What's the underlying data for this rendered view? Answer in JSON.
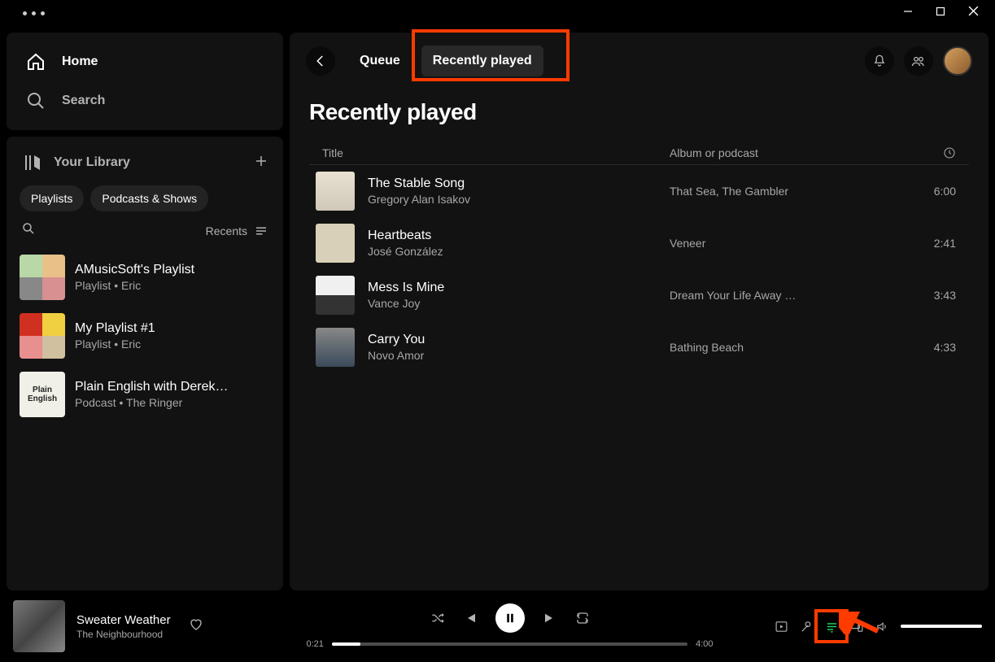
{
  "sidebar": {
    "home": "Home",
    "search": "Search",
    "library": "Your Library",
    "filters": [
      "Playlists",
      "Podcasts & Shows"
    ],
    "recents_label": "Recents",
    "items": [
      {
        "name": "AMusicSoft's Playlist",
        "meta": "Playlist • Eric"
      },
      {
        "name": "My Playlist #1",
        "meta": "Playlist • Eric"
      },
      {
        "name": "Plain English with Derek…",
        "meta": "Podcast • The Ringer"
      }
    ]
  },
  "main": {
    "tabs": {
      "queue": "Queue",
      "recently_played": "Recently played"
    },
    "page_title": "Recently played",
    "columns": {
      "title": "Title",
      "album": "Album or podcast"
    },
    "tracks": [
      {
        "name": "The Stable Song",
        "artist": "Gregory Alan Isakov",
        "album": "That Sea, The Gambler",
        "duration": "6:00"
      },
      {
        "name": "Heartbeats",
        "artist": "José González",
        "album": "Veneer",
        "duration": "2:41"
      },
      {
        "name": "Mess Is Mine",
        "artist": "Vance Joy",
        "album": "Dream Your Life Away …",
        "duration": "3:43"
      },
      {
        "name": "Carry You",
        "artist": "Novo Amor",
        "album": "Bathing Beach",
        "duration": "4:33"
      }
    ]
  },
  "player": {
    "now_playing": {
      "title": "Sweater Weather",
      "artist": "The Neighbourhood"
    },
    "elapsed": "0:21",
    "total": "4:00"
  }
}
